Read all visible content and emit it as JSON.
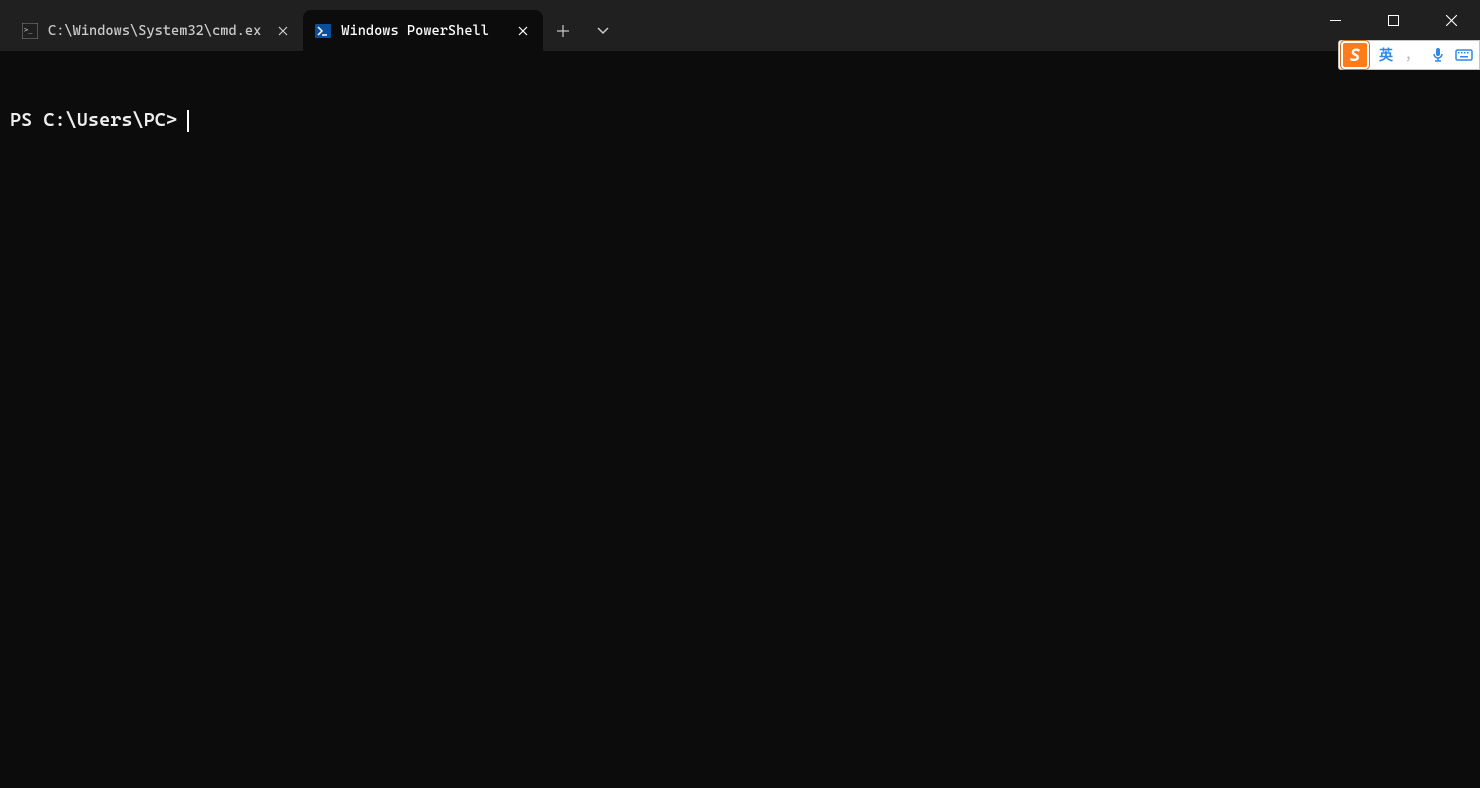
{
  "tabs": [
    {
      "label": "C:\\Windows\\System32\\cmd.ex",
      "icon": "cmd-icon",
      "active": false
    },
    {
      "label": "Windows PowerShell",
      "icon": "powershell-icon",
      "active": true
    }
  ],
  "terminal": {
    "prompt": "PS C:\\Users\\PC>"
  },
  "ime": {
    "logo": "S",
    "lang": "英",
    "punct": "，",
    "items": [
      "mic",
      "keyboard"
    ]
  },
  "window": {
    "controls": [
      "minimize",
      "maximize",
      "close"
    ]
  }
}
